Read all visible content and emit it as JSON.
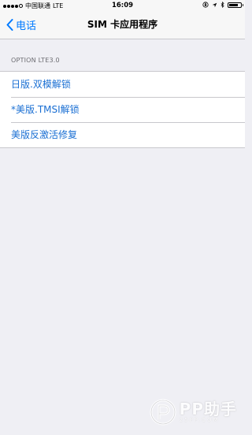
{
  "status_bar": {
    "carrier": "中国联通",
    "network": "LTE",
    "time": "16:09",
    "battery_level": 0.8
  },
  "nav": {
    "back_label": "电话",
    "title": "SIM 卡应用程序"
  },
  "section": {
    "header": "OPTION LTE3.0",
    "items": [
      {
        "label": "日版.双模解锁"
      },
      {
        "label": "*美版.TMSI解锁"
      },
      {
        "label": "美版反激活修复"
      }
    ]
  },
  "watermark": {
    "main": "PP助手",
    "sub": "25PP.COM"
  },
  "colors": {
    "accent": "#007aff",
    "item_text": "#1a6fd3",
    "background": "#efeff4"
  }
}
